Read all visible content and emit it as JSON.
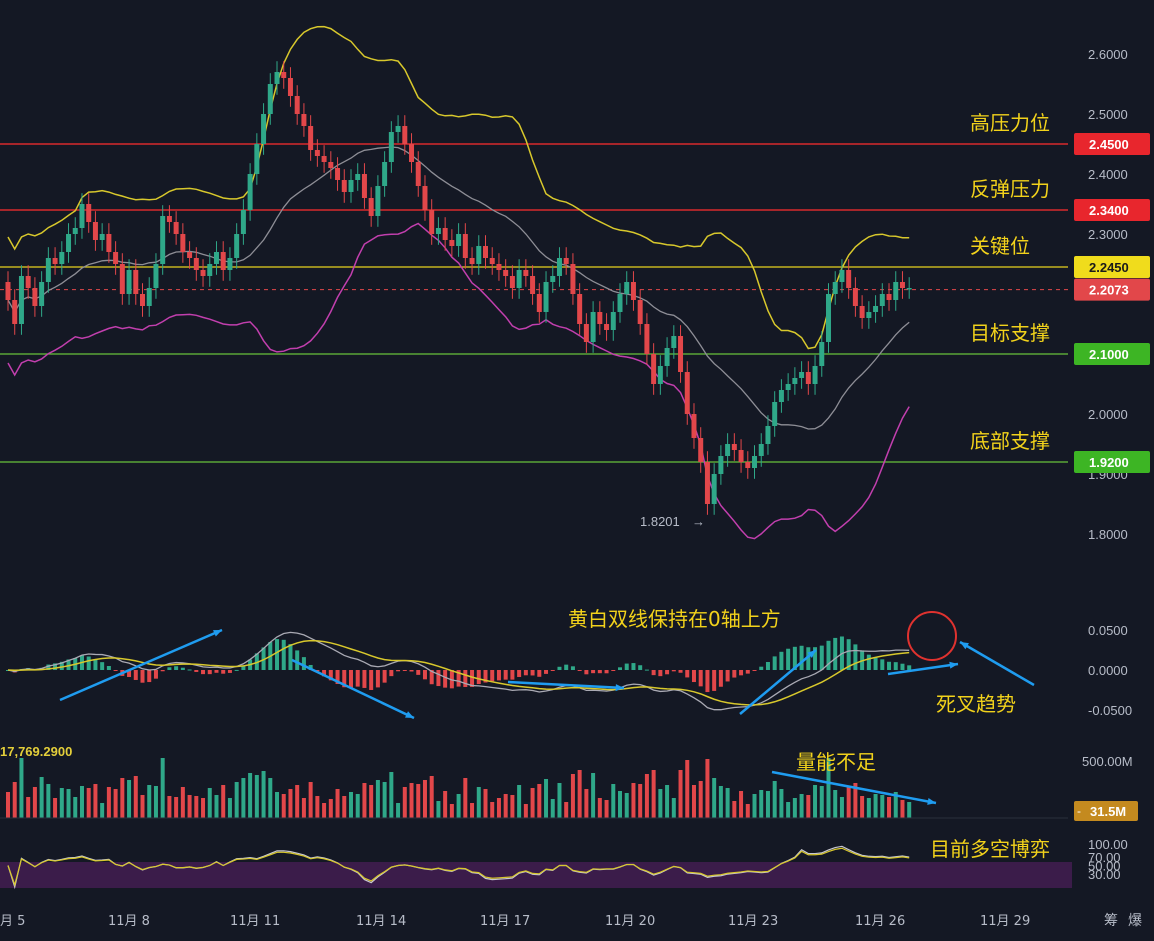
{
  "colors": {
    "background": "#141824",
    "up": "#2fa889",
    "down": "#e2474a",
    "boll_upper": "#d8c82c",
    "boll_mid": "#8e8e96",
    "boll_lower": "#c23fae",
    "resistance": "#ff2d2d",
    "support": "#67c23a",
    "key": "#e8d21d",
    "annotation": "#f2d21b",
    "arrow": "#1f9cf0"
  },
  "price_axis": {
    "ticks": [
      "2.6000",
      "2.5000",
      "2.4000",
      "2.3000",
      "2.0000",
      "1.9000",
      "1.8000"
    ],
    "tick_values": [
      2.6,
      2.5,
      2.4,
      2.3,
      2.0,
      1.9,
      1.8
    ]
  },
  "levels": [
    {
      "value": 2.45,
      "label": "2.4500",
      "annotation": "高压力位",
      "color": "#ff2d2d",
      "badge": "#e8262d"
    },
    {
      "value": 2.34,
      "label": "2.3400",
      "annotation": "反弹压力",
      "color": "#ff2d2d",
      "badge": "#e8262d"
    },
    {
      "value": 2.245,
      "label": "2.2450",
      "annotation": "关键位",
      "color": "#e8d21d",
      "badge": "#f0dc1c"
    },
    {
      "value": 2.1,
      "label": "2.1000",
      "annotation": "目标支撑",
      "color": "#67c23a",
      "badge": "#3db524"
    },
    {
      "value": 1.92,
      "label": "1.9200",
      "annotation": "底部支撑",
      "color": "#67c23a",
      "badge": "#3db524"
    }
  ],
  "current_price": {
    "value": 2.2073,
    "label": "2.2073"
  },
  "low_marker": {
    "value": 1.8201,
    "label": "1.8201"
  },
  "macd_axis": {
    "ticks": [
      "0.0500",
      "0.0000",
      "-0.0500"
    ],
    "values": [
      0.05,
      0.0,
      -0.05
    ]
  },
  "macd_left_readout": "17,769.2900",
  "macd_annotations": {
    "main": "黄白双线保持在0轴上方",
    "cross": "死叉趋势"
  },
  "volume_axis": {
    "top": "500.00M",
    "current": "31.5M"
  },
  "volume_annotation": "量能不足",
  "rsi_axis": {
    "ticks": [
      "100.00",
      "70.00",
      "50.00",
      "30.00"
    ]
  },
  "rsi_annotation": "目前多空博弈",
  "x_axis": {
    "ticks": [
      "月 5",
      "11月 8",
      "11月 11",
      "11月 14",
      "11月 17",
      "11月 20",
      "11月 23",
      "11月 26",
      "11月 29"
    ],
    "tick_positions": [
      0.0,
      3,
      6,
      9,
      12,
      15,
      18,
      21,
      24
    ]
  },
  "bottom_right_icons": [
    "筹",
    "爆"
  ],
  "chart_data": {
    "type": "candlestick",
    "title": "",
    "xlabel": "",
    "ylabel": "",
    "ylim": [
      1.76,
      2.64
    ],
    "candles_per_day": 6,
    "first_day_value": 4.5,
    "close": [
      2.19,
      2.15,
      2.23,
      2.21,
      2.18,
      2.22,
      2.26,
      2.25,
      2.27,
      2.3,
      2.31,
      2.35,
      2.32,
      2.29,
      2.3,
      2.27,
      2.25,
      2.2,
      2.24,
      2.2,
      2.18,
      2.21,
      2.25,
      2.33,
      2.32,
      2.3,
      2.27,
      2.26,
      2.24,
      2.23,
      2.25,
      2.27,
      2.24,
      2.26,
      2.3,
      2.34,
      2.4,
      2.45,
      2.5,
      2.55,
      2.57,
      2.56,
      2.53,
      2.5,
      2.48,
      2.44,
      2.43,
      2.42,
      2.41,
      2.39,
      2.37,
      2.39,
      2.4,
      2.36,
      2.33,
      2.38,
      2.42,
      2.47,
      2.48,
      2.45,
      2.42,
      2.38,
      2.34,
      2.3,
      2.31,
      2.29,
      2.28,
      2.3,
      2.26,
      2.25,
      2.28,
      2.26,
      2.25,
      2.24,
      2.23,
      2.21,
      2.24,
      2.23,
      2.2,
      2.17,
      2.22,
      2.23,
      2.26,
      2.25,
      2.2,
      2.15,
      2.12,
      2.17,
      2.15,
      2.14,
      2.17,
      2.2,
      2.22,
      2.19,
      2.15,
      2.1,
      2.05,
      2.08,
      2.11,
      2.13,
      2.07,
      2.0,
      1.96,
      1.92,
      1.85,
      1.9,
      1.93,
      1.95,
      1.94,
      1.92,
      1.91,
      1.93,
      1.95,
      1.98,
      2.02,
      2.04,
      2.05,
      2.06,
      2.07,
      2.05,
      2.08,
      2.12,
      2.2,
      2.22,
      2.24,
      2.21,
      2.18,
      2.16,
      2.17,
      2.18,
      2.2,
      2.19,
      2.22,
      2.21,
      2.21
    ],
    "open": [
      2.22,
      2.19,
      2.15,
      2.23,
      2.21,
      2.18,
      2.22,
      2.26,
      2.25,
      2.27,
      2.3,
      2.31,
      2.35,
      2.32,
      2.29,
      2.3,
      2.27,
      2.25,
      2.2,
      2.24,
      2.2,
      2.18,
      2.21,
      2.25,
      2.33,
      2.32,
      2.3,
      2.27,
      2.26,
      2.24,
      2.23,
      2.25,
      2.27,
      2.24,
      2.26,
      2.3,
      2.34,
      2.4,
      2.45,
      2.5,
      2.55,
      2.57,
      2.56,
      2.53,
      2.5,
      2.48,
      2.44,
      2.43,
      2.42,
      2.41,
      2.39,
      2.37,
      2.39,
      2.4,
      2.36,
      2.33,
      2.38,
      2.42,
      2.47,
      2.48,
      2.45,
      2.42,
      2.38,
      2.34,
      2.3,
      2.31,
      2.29,
      2.28,
      2.3,
      2.26,
      2.25,
      2.28,
      2.26,
      2.25,
      2.24,
      2.23,
      2.21,
      2.24,
      2.23,
      2.2,
      2.17,
      2.22,
      2.23,
      2.26,
      2.25,
      2.2,
      2.15,
      2.12,
      2.17,
      2.15,
      2.14,
      2.17,
      2.2,
      2.22,
      2.19,
      2.15,
      2.1,
      2.05,
      2.08,
      2.11,
      2.13,
      2.07,
      2.0,
      1.96,
      1.92,
      1.85,
      1.9,
      1.93,
      1.95,
      1.94,
      1.92,
      1.91,
      1.93,
      1.95,
      1.98,
      2.02,
      2.04,
      2.05,
      2.06,
      2.07,
      2.05,
      2.08,
      2.12,
      2.2,
      2.22,
      2.24,
      2.21,
      2.18,
      2.16,
      2.17,
      2.18,
      2.2,
      2.19,
      2.22,
      2.21
    ]
  }
}
